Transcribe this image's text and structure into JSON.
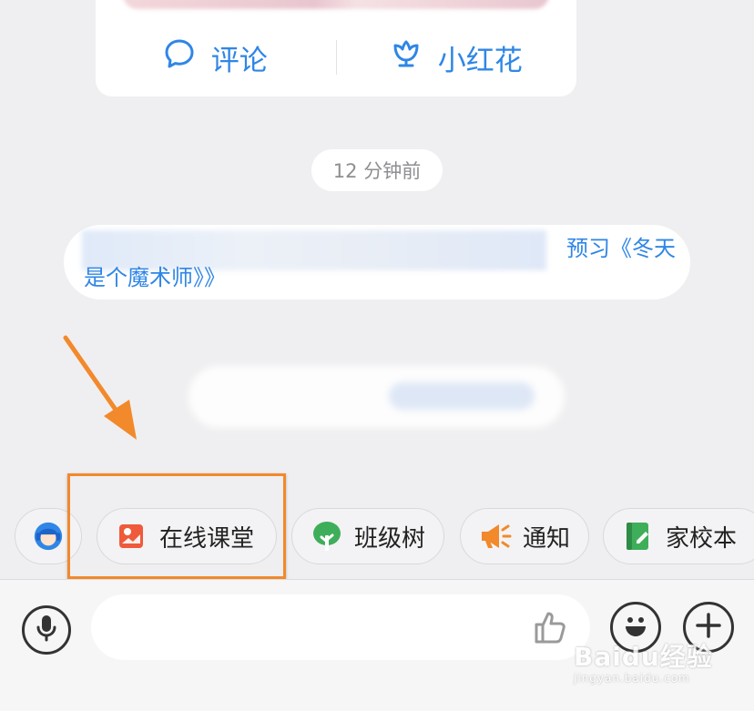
{
  "post_card": {
    "comment_label": "评论",
    "flower_label": "小红花"
  },
  "timestamp": "12 分钟前",
  "message": {
    "line1_visible": "预习《冬天",
    "line2": "是个魔术师》》"
  },
  "quick_actions": [
    {
      "label": "",
      "icon": "assistant-avatar-icon"
    },
    {
      "label": "在线课堂",
      "icon": "online-class-icon"
    },
    {
      "label": "班级树",
      "icon": "class-tree-icon"
    },
    {
      "label": "通知",
      "icon": "megaphone-icon"
    },
    {
      "label": "家校本",
      "icon": "notebook-icon"
    }
  ],
  "input": {
    "placeholder": ""
  },
  "watermark": {
    "brand": "Baidu经验",
    "url": "jingyan.baidu.com"
  },
  "colors": {
    "accent_blue": "#2f86e6",
    "highlight_orange": "#f2892b",
    "background": "#efeff1"
  }
}
